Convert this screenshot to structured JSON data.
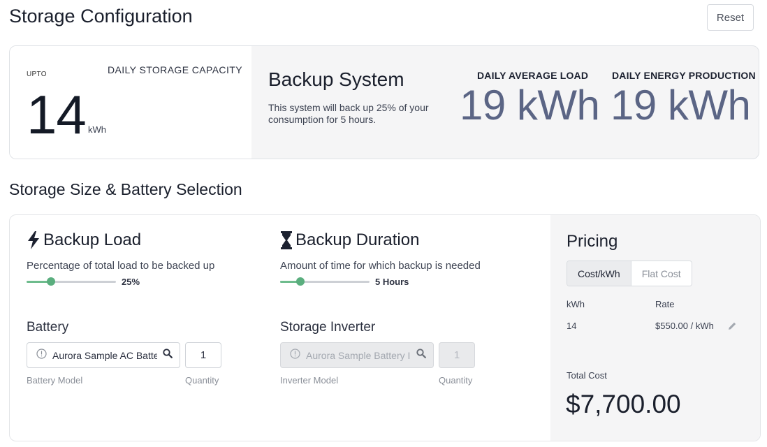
{
  "header": {
    "title": "Storage Configuration",
    "reset_label": "Reset"
  },
  "summary": {
    "upto_label": "UPTO",
    "capacity_label": "DAILY STORAGE CAPACITY",
    "capacity_value": "14",
    "capacity_unit": "kWh",
    "backup_title": "Backup System",
    "backup_description": "This system will back up 25% of your consumption for 5 hours.",
    "avg_load_label": "DAILY AVERAGE LOAD",
    "avg_load_value": "19 kWh",
    "production_label": "DAILY ENERGY PRODUCTION",
    "production_value": "19 kWh"
  },
  "section": {
    "title": "Storage Size & Battery Selection"
  },
  "backup_load": {
    "title": "Backup Load",
    "icon": "lightning-bolt-icon",
    "subtitle": "Percentage of total load to be backed up",
    "slider_value_label": "25%",
    "slider_level": 0.27
  },
  "backup_duration": {
    "title": "Backup Duration",
    "icon": "hourglass-icon",
    "subtitle": "Amount of time for which backup is needed",
    "slider_value_label": "5 Hours",
    "slider_level": 0.23
  },
  "battery": {
    "title": "Battery",
    "model_value": "Aurora Sample AC Battery",
    "model_caption": "Battery Model",
    "quantity_value": "1",
    "quantity_caption": "Quantity"
  },
  "inverter": {
    "title": "Storage Inverter",
    "model_value": "Aurora Sample Battery Inverter",
    "model_caption": "Inverter Model",
    "quantity_value": "1",
    "quantity_caption": "Quantity"
  },
  "pricing": {
    "title": "Pricing",
    "tabs": [
      {
        "label": "Cost/kWh",
        "active": true
      },
      {
        "label": "Flat Cost",
        "active": false
      }
    ],
    "col_kwh": "kWh",
    "col_rate": "Rate",
    "kwh_value": "14",
    "rate_value": "$550.00 / kWh",
    "total_label": "Total Cost",
    "total_value": "$7,700.00"
  },
  "colors": {
    "slider_fill": "#6ebc8d",
    "slider_thumb": "#5aae7e",
    "stat_value": "#5b6585",
    "panel_gray": "#f5f5f6"
  }
}
